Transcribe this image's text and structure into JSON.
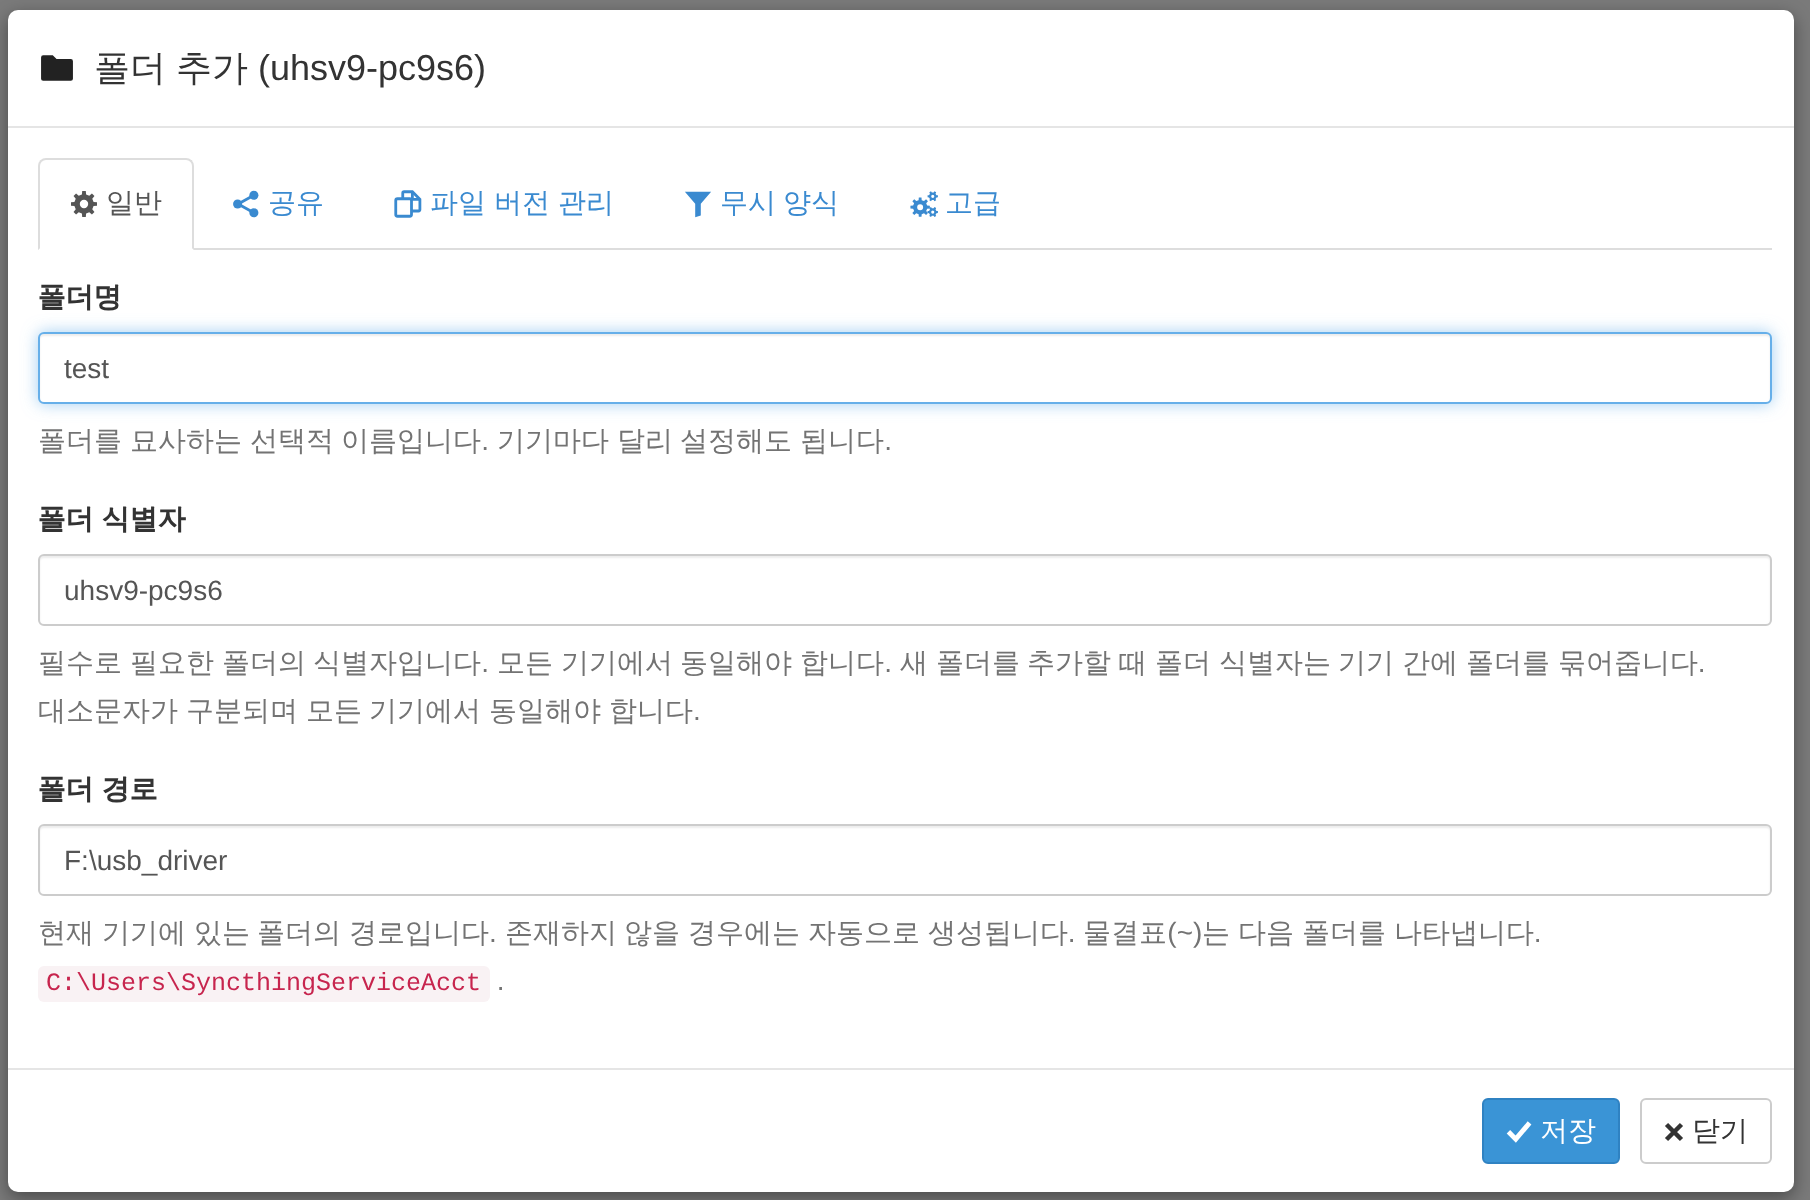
{
  "dialog": {
    "title": "폴더 추가 (uhsv9-pc9s6)"
  },
  "tabs": [
    {
      "label": "일반",
      "selected": true
    },
    {
      "label": "공유",
      "selected": false
    },
    {
      "label": "파일 버전 관리",
      "selected": false
    },
    {
      "label": "무시 양식",
      "selected": false
    },
    {
      "label": "고급",
      "selected": false
    }
  ],
  "fields": [
    {
      "label": "폴더명",
      "value": "test",
      "focused": true,
      "help": "폴더를 묘사하는 선택적 이름입니다. 기기마다 달리 설정해도 됩니다."
    },
    {
      "label": "폴더 식별자",
      "value": "uhsv9-pc9s6",
      "focused": false,
      "help": "필수로 필요한 폴더의 식별자입니다. 모든 기기에서 동일해야 합니다. 새 폴더를 추가할 때 폴더 식별자는 기기 간에 폴더를 묶어줍니다. 대소문자가 구분되며 모든 기기에서 동일해야 합니다."
    },
    {
      "label": "폴더 경로",
      "value": "F:\\usb_driver",
      "focused": false,
      "help": "현재 기기에 있는 폴더의 경로입니다. 존재하지 않을 경우에는 자동으로 생성됩니다. 물결표(~)는 다음 폴더를 나타냅니다.",
      "help_code": "C:\\Users\\SyncthingServiceAcct",
      "help_end": "."
    }
  ],
  "buttons": [
    {
      "label": "저장",
      "kind": "primary"
    },
    {
      "label": "닫기",
      "kind": "default"
    }
  ]
}
